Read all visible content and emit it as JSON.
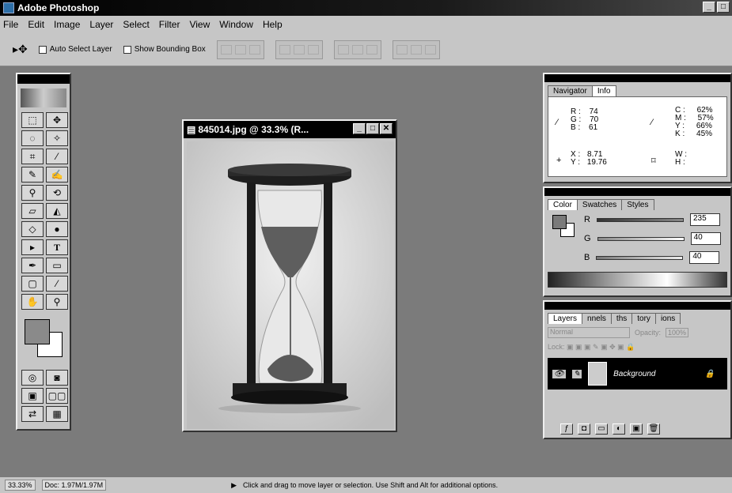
{
  "app": {
    "title": "Adobe Photoshop"
  },
  "menu": [
    "File",
    "Edit",
    "Image",
    "Layer",
    "Select",
    "Filter",
    "View",
    "Window",
    "Help"
  ],
  "options": {
    "auto_select": "Auto Select Layer",
    "show_bbox": "Show Bounding Box"
  },
  "document": {
    "title": "845014.jpg @ 33.3% (R..."
  },
  "navigator_tabs": [
    "Navigator",
    "Info"
  ],
  "info": {
    "rgb": [
      {
        "k": "R :",
        "v": "74"
      },
      {
        "k": "G :",
        "v": "70"
      },
      {
        "k": "B :",
        "v": "61"
      }
    ],
    "cmyk": [
      {
        "k": "C :",
        "v": "62%"
      },
      {
        "k": "M :",
        "v": "57%"
      },
      {
        "k": "Y :",
        "v": "66%"
      },
      {
        "k": "K :",
        "v": "45%"
      }
    ],
    "xy": [
      {
        "k": "X :",
        "v": "8.71"
      },
      {
        "k": "Y :",
        "v": "19.76"
      }
    ],
    "wh": [
      {
        "k": "W :",
        "v": ""
      },
      {
        "k": "H :",
        "v": ""
      }
    ]
  },
  "color_tabs": [
    "Color",
    "Swatches",
    "Styles"
  ],
  "color": {
    "r_label": "R",
    "g_label": "G",
    "b_label": "B",
    "r": "235",
    "g": "40",
    "b": "40"
  },
  "layers_tabs": [
    "Layers",
    "nnels",
    "ths",
    "tory",
    "ions"
  ],
  "layers": {
    "blend": "Normal",
    "opacity_label": "Opacity:",
    "opacity": "100%",
    "lock_label": "Lock:",
    "layer_name": "Background"
  },
  "status": {
    "zoom": "33.33%",
    "doc": "Doc: 1.97M/1.97M",
    "hint": "Click and drag to move layer or selection. Use Shift and Alt for additional options."
  }
}
